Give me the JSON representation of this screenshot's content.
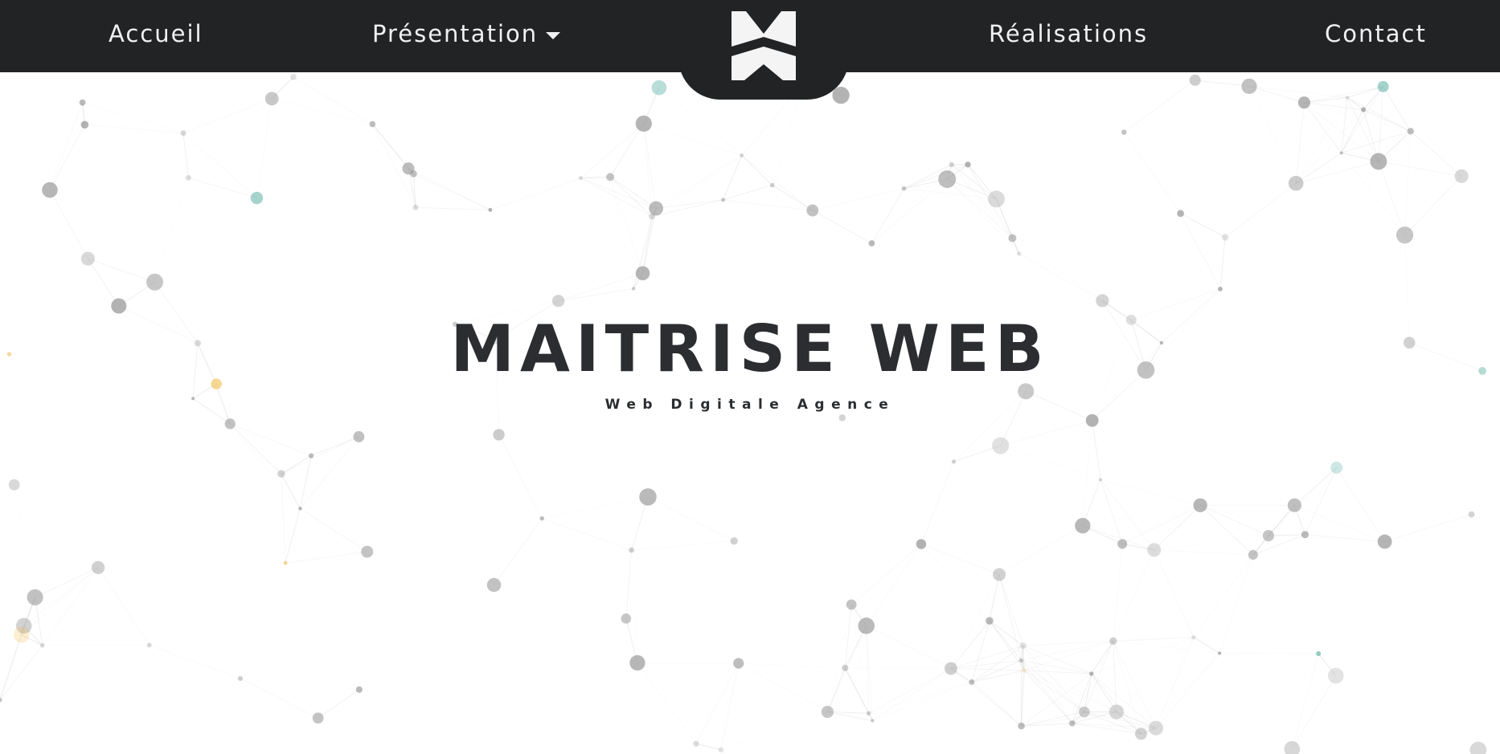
{
  "nav": {
    "left_items": [
      {
        "label": "Accueil"
      },
      {
        "label": "Présentation",
        "has_dropdown": true
      }
    ],
    "right_items": [
      {
        "label": "Réalisations"
      },
      {
        "label": "Contact"
      }
    ],
    "logo_icon": "stylized-mw-monogram-icon"
  },
  "hero": {
    "title": "MAITRISE WEB",
    "subtitle": "Web Digitale Agence"
  },
  "colors": {
    "navbar_background": "#222325",
    "nav_text": "#f1f1f1",
    "title_text": "#2b2d30",
    "node_gray": "#8f8f8f",
    "node_teal": "#4aa89a",
    "node_yellow": "#f2c25a",
    "link_line": "#cfcfcf"
  },
  "background": {
    "type": "particle-network",
    "description_icon": "network-graph-icon"
  }
}
